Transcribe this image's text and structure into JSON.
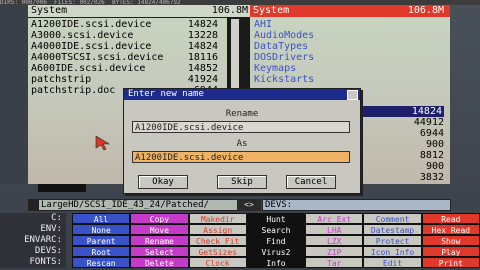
{
  "top_info": "DIRS: 000/006  FILES: 002/026  BYTES: 14824/406792",
  "left_panel": {
    "header_label": "System",
    "header_size": "106.8M",
    "files": [
      {
        "name": "A1200IDE.scsi.device",
        "size": "14824"
      },
      {
        "name": "A3000.scsi.device",
        "size": "13228"
      },
      {
        "name": "A4000IDE.scsi.device",
        "size": "14824"
      },
      {
        "name": "A4000TSCSI.scsi.device",
        "size": "18116"
      },
      {
        "name": "A600IDE.scsi.device",
        "size": "14852"
      },
      {
        "name": "patchstrip",
        "size": "41924"
      },
      {
        "name": "patchstrip.doc",
        "size": "6944"
      }
    ]
  },
  "right_panel": {
    "header_label": "System",
    "header_size": "106.8M",
    "dirs": [
      "AHI",
      "AudioModes",
      "DataTypes",
      "DOSDrivers",
      "Keymaps",
      "Kickstarts"
    ],
    "sizes": [
      {
        "value": "14824",
        "selected": true
      },
      {
        "value": "44912",
        "selected": false
      },
      {
        "value": "6944",
        "selected": false
      },
      {
        "value": "900",
        "selected": false
      },
      {
        "value": "8812",
        "selected": false
      },
      {
        "value": "900",
        "selected": false
      },
      {
        "value": "3832",
        "selected": false
      }
    ]
  },
  "dialog": {
    "title": "Enter new name",
    "rename_label": "Rename",
    "rename_value": "A1200IDE.scsi.device",
    "as_label": "As",
    "as_value": "A1200IDE.scsi.device",
    "okay": "Okay",
    "skip": "Skip",
    "cancel": "Cancel"
  },
  "path_left": "LargeHD/SCSI_IDE_43_24/Patched/",
  "path_right": "DEVS:",
  "devices": [
    "C:",
    "ENV:",
    "ENVARC:",
    "DEVS:",
    "FONTS:"
  ],
  "buttons": [
    [
      "All",
      "Copy",
      "Makedir",
      "Hunt",
      "Arc Ext",
      "Comment",
      "Read"
    ],
    [
      "None",
      "Move",
      "Assign",
      "Search",
      "LHA",
      "Datestamp",
      "Hex Read"
    ],
    [
      "Parent",
      "Rename",
      "Check Fit",
      "Find",
      "LZX",
      "Protect",
      "Show"
    ],
    [
      "Root",
      "Select",
      "GetSizes",
      "Virus2",
      "ZIP",
      "Icon Info",
      "Play"
    ],
    [
      "Rescan",
      "Delete",
      "Clock",
      "Info",
      "Tar",
      "Edit",
      "Print"
    ]
  ],
  "colors": {
    "red": "#e0382a",
    "blue": "#3a52c8",
    "orange": "#f0b264",
    "selection": "#1d1f6a"
  }
}
